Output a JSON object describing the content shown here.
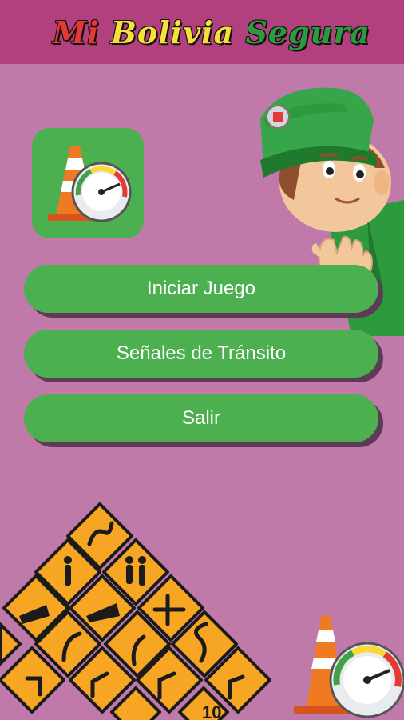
{
  "header": {
    "title_word1": "Mi",
    "title_word2": "Bolivia",
    "title_word3": "Segura"
  },
  "menu": {
    "start_label": "Iniciar Juego",
    "signs_label": "Señales de Tránsito",
    "exit_label": "Salir"
  },
  "colors": {
    "background": "#c07aa9",
    "topbar": "#b2407f",
    "button": "#4caf50",
    "button_shadow": "#5b3c54"
  },
  "icons": {
    "logo": "cone-speedometer-icon",
    "mascot": "traffic-officer-illustration",
    "signs": "road-signs-pile",
    "corner": "cone-speedometer-icon"
  }
}
